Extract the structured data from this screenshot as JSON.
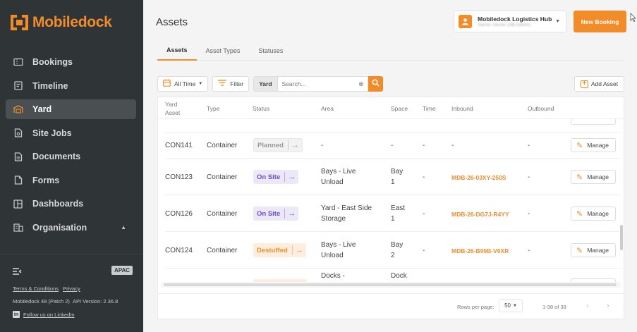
{
  "brand": {
    "name": "Mobiledock",
    "accent": "#f28c28",
    "sidebar_bg": "#2f3537"
  },
  "sidebar": {
    "items": [
      {
        "label": "Bookings",
        "icon": "ticket-icon",
        "active": false
      },
      {
        "label": "Timeline",
        "icon": "timeline-icon",
        "active": false
      },
      {
        "label": "Yard",
        "icon": "yard-icon",
        "active": true
      },
      {
        "label": "Site Jobs",
        "icon": "site-jobs-icon",
        "active": false
      },
      {
        "label": "Documents",
        "icon": "document-icon",
        "active": false
      },
      {
        "label": "Forms",
        "icon": "form-icon",
        "active": false
      },
      {
        "label": "Dashboards",
        "icon": "dashboard-icon",
        "active": false
      },
      {
        "label": "Organisation",
        "icon": "building-icon",
        "active": false,
        "expanded": true
      }
    ],
    "region_badge": "APAC",
    "terms_link": "Terms & Conditions",
    "privacy_link": "Privacy",
    "version": "Mobiledock 48 (Patch 2)",
    "api_version": "API Version: 2.36.8",
    "linkedin_link": "Follow us on LinkedIn"
  },
  "header": {
    "title": "Assets",
    "org_name": "Mobiledock Logistics Hub",
    "org_user": "Owner Owner (HB Admin)",
    "new_booking_label": "New Booking"
  },
  "tabs": [
    {
      "label": "Assets",
      "active": true
    },
    {
      "label": "Asset Types",
      "active": false
    },
    {
      "label": "Statuses",
      "active": false
    }
  ],
  "toolbar": {
    "date_filter": "All Time",
    "filter_label": "Filter",
    "search_scope": "Yard",
    "search_placeholder": "Search...",
    "add_asset_label": "Add Asset"
  },
  "table": {
    "columns": [
      "Yard\nAsset",
      "Type",
      "Status",
      "Area",
      "Space",
      "Time",
      "Inbound",
      "Outbound"
    ],
    "column_yard": "Yard",
    "column_asset": "Asset",
    "rows": [
      {
        "asset": "CON141",
        "type": "Container",
        "status": "Planned",
        "status_kind": "planned",
        "area_1": "-",
        "area_2": "",
        "space_1": "-",
        "space_2": "",
        "time": "-",
        "inbound": "-",
        "outbound": "-",
        "action": "Manage"
      },
      {
        "asset": "CON123",
        "type": "Container",
        "status": "On Site",
        "status_kind": "onsite",
        "area_1": "Bays - Live",
        "area_2": "Unload",
        "space_1": "Bay",
        "space_2": "1",
        "time": "-",
        "inbound": "MDB-26-03XY-250S",
        "outbound": "-",
        "action": "Manage"
      },
      {
        "asset": "CON126",
        "type": "Container",
        "status": "On Site",
        "status_kind": "onsite",
        "area_1": "Yard - East Side",
        "area_2": "Storage",
        "space_1": "East",
        "space_2": "1",
        "time": "-",
        "inbound": "MDB-26-DG7J-R4YY",
        "outbound": "-",
        "action": "Manage"
      },
      {
        "asset": "CON124",
        "type": "Container",
        "status": "Destuffed",
        "status_kind": "destuffed",
        "area_1": "Bays - Live",
        "area_2": "Unload",
        "space_1": "Bay",
        "space_2": "2",
        "time": "-",
        "inbound": "MDB-26-B99B-V6XR",
        "outbound": "-",
        "action": "Manage"
      }
    ],
    "partial_bottom": {
      "area": "Docks -",
      "space": "Dock"
    }
  },
  "pagination": {
    "rows_per_page_label": "Rows per page:",
    "rows_per_page": "50",
    "range": "1-38 of 38"
  }
}
